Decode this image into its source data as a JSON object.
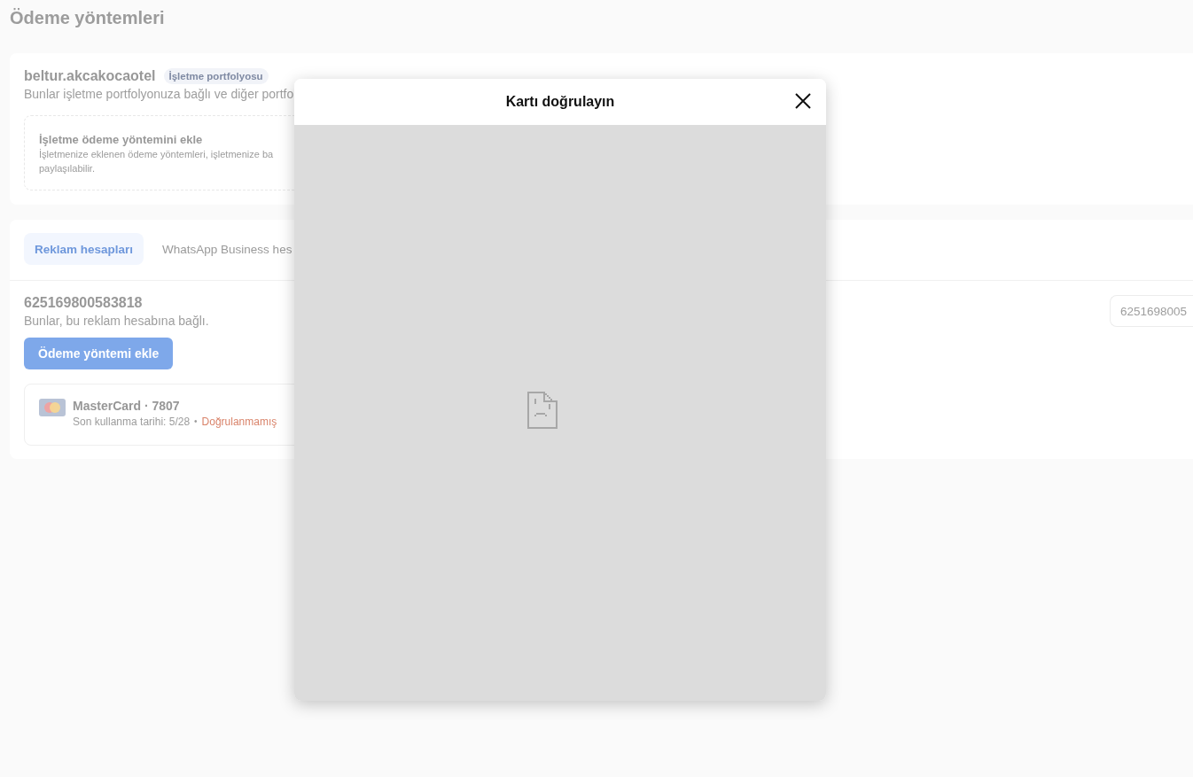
{
  "page": {
    "title": "Ödeme yöntemleri"
  },
  "portfolio_card": {
    "name": "beltur.akcakocaotel",
    "badge": "İşletme portfolyosu",
    "description": "Bunlar işletme portfolyonuza bağlı ve diğer portfo",
    "add_option": {
      "title": "İşletme ödeme yöntemini ekle",
      "description_lines": [
        "İşletmenize eklenen ödeme yöntemleri, işletmenize ba",
        "paylaşılabilir."
      ]
    }
  },
  "accounts_card": {
    "tabs": [
      {
        "label": "Reklam hesapları",
        "selected": true
      },
      {
        "label": "WhatsApp Business hes",
        "selected": false
      }
    ],
    "account": {
      "id": "625169800583818",
      "description": "Bunlar, bu reklam hesabına bağlı.",
      "add_button": "Ödeme yöntemi ekle",
      "account_selector": {
        "value": "6251698005"
      }
    },
    "payment_methods": [
      {
        "kind": "mastercard",
        "title": "MasterCard · 7807",
        "expiry": "Son kullanma tarihi: 5/28",
        "separator": "•",
        "status": "Doğrulanmamış",
        "verified": false
      }
    ]
  },
  "modal": {
    "title": "Kartı doğrulayın"
  }
}
